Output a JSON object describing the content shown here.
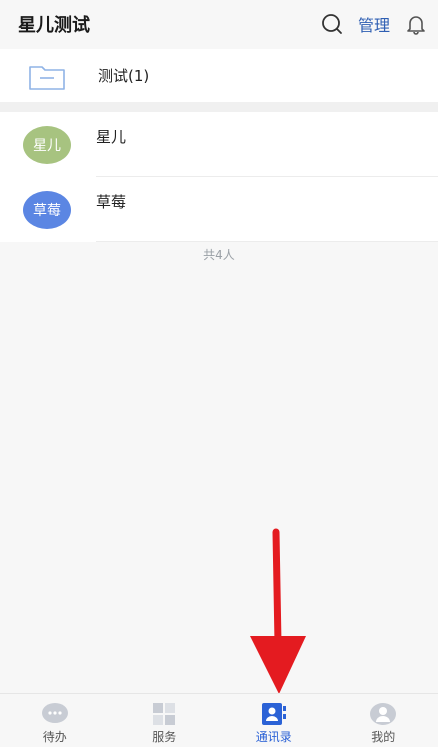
{
  "header": {
    "title": "星儿测试",
    "manage_label": "管理",
    "icons": {
      "search": "search-icon",
      "bell": "bell-icon"
    }
  },
  "folder": {
    "label": "测试(1)",
    "icon": "folder-icon"
  },
  "contacts": [
    {
      "avatar_text": "星儿",
      "name": "星儿",
      "avatar_color": "#a7c380"
    },
    {
      "avatar_text": "草莓",
      "name": "草莓",
      "avatar_color": "#5b86e3"
    }
  ],
  "summary": {
    "total": "共4人"
  },
  "tabbar": {
    "active": "通讯录",
    "tabs": [
      {
        "label": "待办",
        "icon": "chat-bubble-icon"
      },
      {
        "label": "服务",
        "icon": "grid-icon"
      },
      {
        "label": "通讯录",
        "icon": "contacts-book-icon"
      },
      {
        "label": "我的",
        "icon": "profile-icon"
      }
    ]
  },
  "colors": {
    "accent": "#2b62d6",
    "arrow": "#e41b20"
  }
}
